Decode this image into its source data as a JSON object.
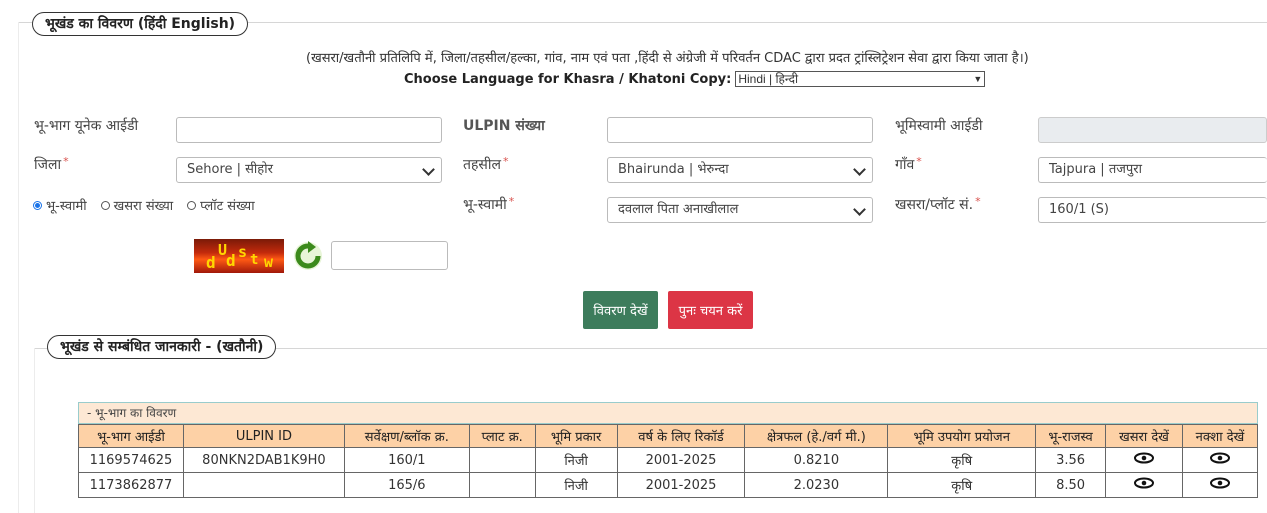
{
  "section1": {
    "legend": "भूखंड का विवरण  (हिंदी  English)",
    "note": "(खसरा/खतौनी प्रतिलिपि में, जिला/तहसील/हल्का, गांव, नाम एवं पता ,हिंदी से अंग्रेजी में परिवर्तन CDAC द्वारा प्रदत ट्रांस्लिट्रेशन सेवा द्वारा किया जाता है।)",
    "language_label": "Choose Language for Khasra / Khatoni Copy:",
    "language_value": "Hindi | हिन्दी"
  },
  "form": {
    "unique_id_label": "भू-भाग यूनेक आईडी",
    "unique_id_value": "",
    "ulpin_label": "ULPIN संख्या",
    "ulpin_value": "",
    "owner_id_label": "भूमिस्वामी आईडी",
    "owner_id_value": "",
    "district_label": "जिला",
    "district_value": "Sehore | सीहोर",
    "tehsil_label": "तहसील",
    "tehsil_value": "Bhairunda | भेरुन्दा",
    "village_label": "गाँव",
    "village_value": "Tajpura | तजपुरा",
    "radio_owner": "भू-स्वामी",
    "radio_khasra": "खसरा संख्या",
    "radio_plot": "प्लॉट संख्या",
    "owner_label": "भू-स्वामी",
    "owner_value": "दवलाल पिता अनाखीलाल",
    "khasra_label": "खसरा/प्लॉट सं.",
    "khasra_value": "160/1 (S)",
    "required_mark": "*",
    "captcha_chars": [
      "d",
      "U",
      "d",
      "s",
      "t",
      "w"
    ],
    "captcha_input": ""
  },
  "buttons": {
    "view": "विवरण देखें",
    "reset": "पुनः चयन करें"
  },
  "section2": {
    "legend": "भूखंड से सम्बंधित जानकारी -   (खतौनी)",
    "caption": "- भू-भाग का विवरण"
  },
  "table": {
    "headers": [
      "भू-भाग आईडी",
      "ULPIN ID",
      "सर्वेक्षण/ब्लॉक क्र.",
      "प्लाट क्र.",
      "भूमि प्रकार",
      "वर्ष के लिए रिकॉर्ड",
      "क्षेत्रफल (हे./वर्ग मी.)",
      "भूमि उपयोग प्रयोजन",
      "भू-राजस्व",
      "खसरा देखें",
      "नक्शा देखें"
    ],
    "rows": [
      [
        "1169574625",
        "80NKN2DAB1K9H0",
        "160/1",
        "",
        "निजी",
        "2001-2025",
        "0.8210",
        "कृषि",
        "3.56"
      ],
      [
        "1173862877",
        "",
        "165/6",
        "",
        "निजी",
        "2001-2025",
        "2.0230",
        "कृषि",
        "8.50"
      ]
    ]
  },
  "colors": {
    "view_button": "#3d7c5c",
    "reset_button": "#dc3545",
    "table_header": "#fdd1a6",
    "caption_bg": "#fde8d4"
  },
  "icons": {
    "refresh": "refresh-icon",
    "view_khasra": "eye-icon",
    "view_map": "eye-icon"
  }
}
